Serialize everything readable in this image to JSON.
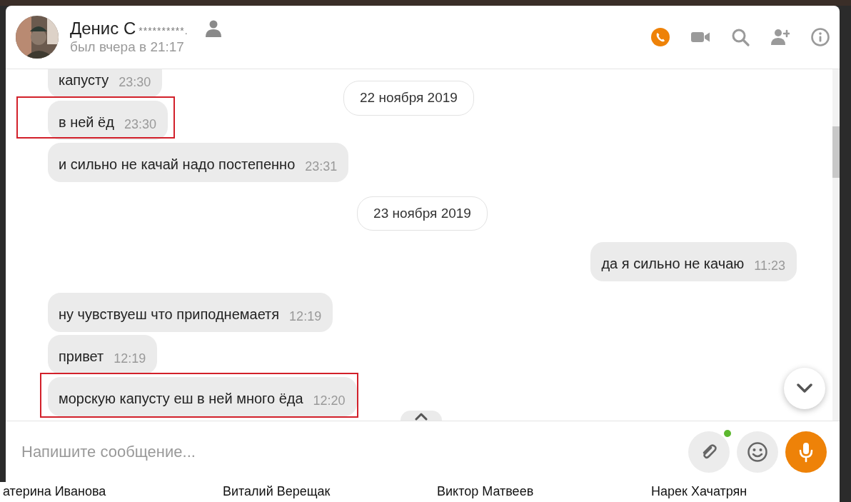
{
  "contact": {
    "name": "Денис С",
    "name_mask": "**********.",
    "status": "был вчера в 21:17"
  },
  "header_actions": [
    {
      "kind": "call",
      "active": true
    },
    {
      "kind": "video",
      "active": false
    },
    {
      "kind": "search",
      "active": false
    },
    {
      "kind": "add-user",
      "active": false
    },
    {
      "kind": "info",
      "active": false
    }
  ],
  "sticky_date": "22 ноября 2019",
  "messages": [
    {
      "kind": "incoming",
      "text": "капусту",
      "time": "23:30",
      "highlighted": false
    },
    {
      "kind": "incoming",
      "text": "в ней ёд",
      "time": "23:30",
      "highlighted": true
    },
    {
      "kind": "incoming",
      "text": "и сильно не качай надо постепенно",
      "time": "23:31",
      "highlighted": false
    },
    {
      "kind": "date",
      "text": "23 ноября 2019"
    },
    {
      "kind": "outgoing",
      "text": "да я сильно не качаю",
      "time": "11:23",
      "highlighted": false
    },
    {
      "kind": "incoming",
      "text": "ну чувствуеш что приподнемаетя",
      "time": "12:19",
      "highlighted": false
    },
    {
      "kind": "incoming",
      "text": "привет",
      "time": "12:19",
      "highlighted": false
    },
    {
      "kind": "incoming",
      "text": "морскую капусту еш в ней много ёда",
      "time": "12:20",
      "highlighted": true
    }
  ],
  "composer": {
    "placeholder": "Напишите сообщение...",
    "attach_has_notification": true
  },
  "background_names": [
    "атерина Иванова",
    "Виталий Верещак",
    "Виктор Матвеев",
    "Нарек Хачатрян"
  ]
}
